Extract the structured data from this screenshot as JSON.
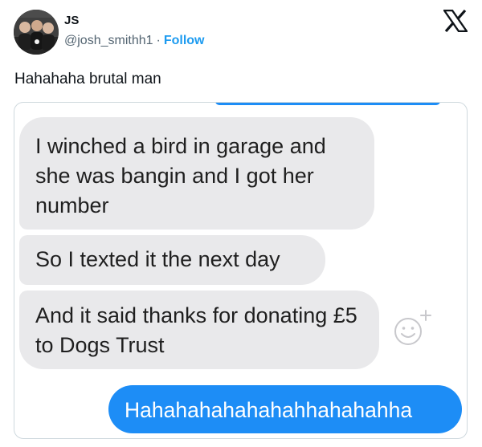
{
  "author": {
    "name": "JS",
    "handle": "@josh_smithh1",
    "separator": "·",
    "follow_label": "Follow"
  },
  "platform_icon": "x-logo-icon",
  "tweet": {
    "text": "Hahahaha brutal man"
  },
  "media": {
    "messages": [
      {
        "from": "other",
        "text": "I winched a bird in garage and she was bangin and I got her number"
      },
      {
        "from": "other",
        "text": "So I texted it the next day"
      },
      {
        "from": "other",
        "text": "And it said thanks for donating £5 to Dogs Trust"
      },
      {
        "from": "me",
        "text": "Hahahahahahahahhahahahha"
      }
    ],
    "reaction_icon": "smiley-add-reaction-icon"
  },
  "colors": {
    "follow_blue": "#1d9bf0",
    "sent_bubble": "#1d8df6",
    "received_bubble": "#e9e9eb",
    "text_primary": "#0f1419",
    "text_secondary": "#536471"
  }
}
